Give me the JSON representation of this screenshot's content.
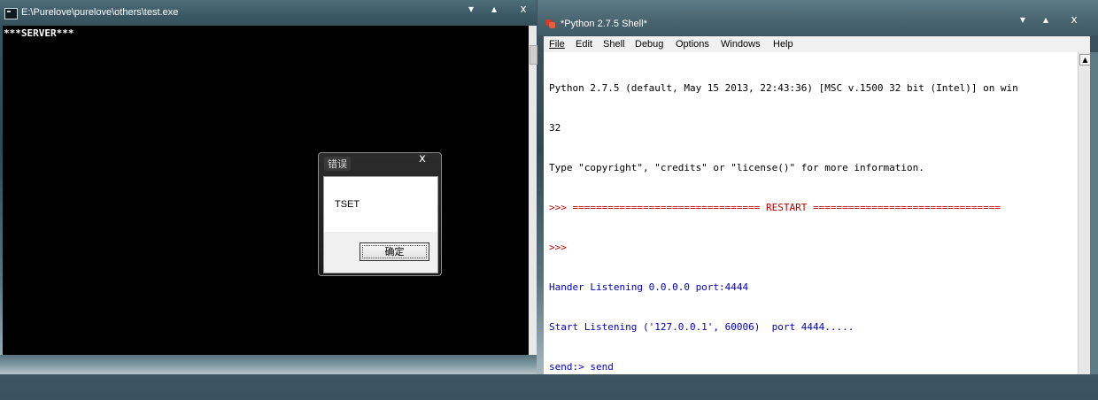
{
  "console": {
    "title": "E:\\Purelove\\purelove\\others\\test.exe",
    "output": "***SERVER***",
    "min_glyph": "▾",
    "max_glyph": "▴",
    "close_glyph": "x"
  },
  "dialog": {
    "title": "错误",
    "message": "TSET",
    "ok_label": "确定",
    "close_glyph": "x"
  },
  "shell": {
    "title": "*Python 2.7.5 Shell*",
    "min_glyph": "▾",
    "max_glyph": "▴",
    "close_glyph": "x",
    "menu": [
      "File",
      "Edit",
      "Shell",
      "Debug",
      "Options",
      "Windows",
      "Help"
    ],
    "lines": [
      {
        "text": "Python 2.7.5 (default, May 15 2013, 22:43:36) [MSC v.1500 32 bit (Intel)] on win",
        "color": "#000000"
      },
      {
        "text": "32",
        "color": "#000000"
      },
      {
        "text": "Type \"copyright\", \"credits\" or \"license()\" for more information.",
        "color": "#000000"
      },
      {
        "text": ">>> ================================ RESTART ================================",
        "color": "#c00000"
      },
      {
        "text": ">>> ",
        "color": "#c00000"
      },
      {
        "text": "Hander Listening 0.0.0.0 port:4444",
        "color": "#0000c0"
      },
      {
        "text": "Start Listening ('127.0.0.1', 60006)  port 4444.....",
        "color": "#0000c0"
      },
      {
        "text": "send:> send",
        "color": "#0000c0"
      }
    ],
    "scroll_up_glyph": "▲"
  }
}
